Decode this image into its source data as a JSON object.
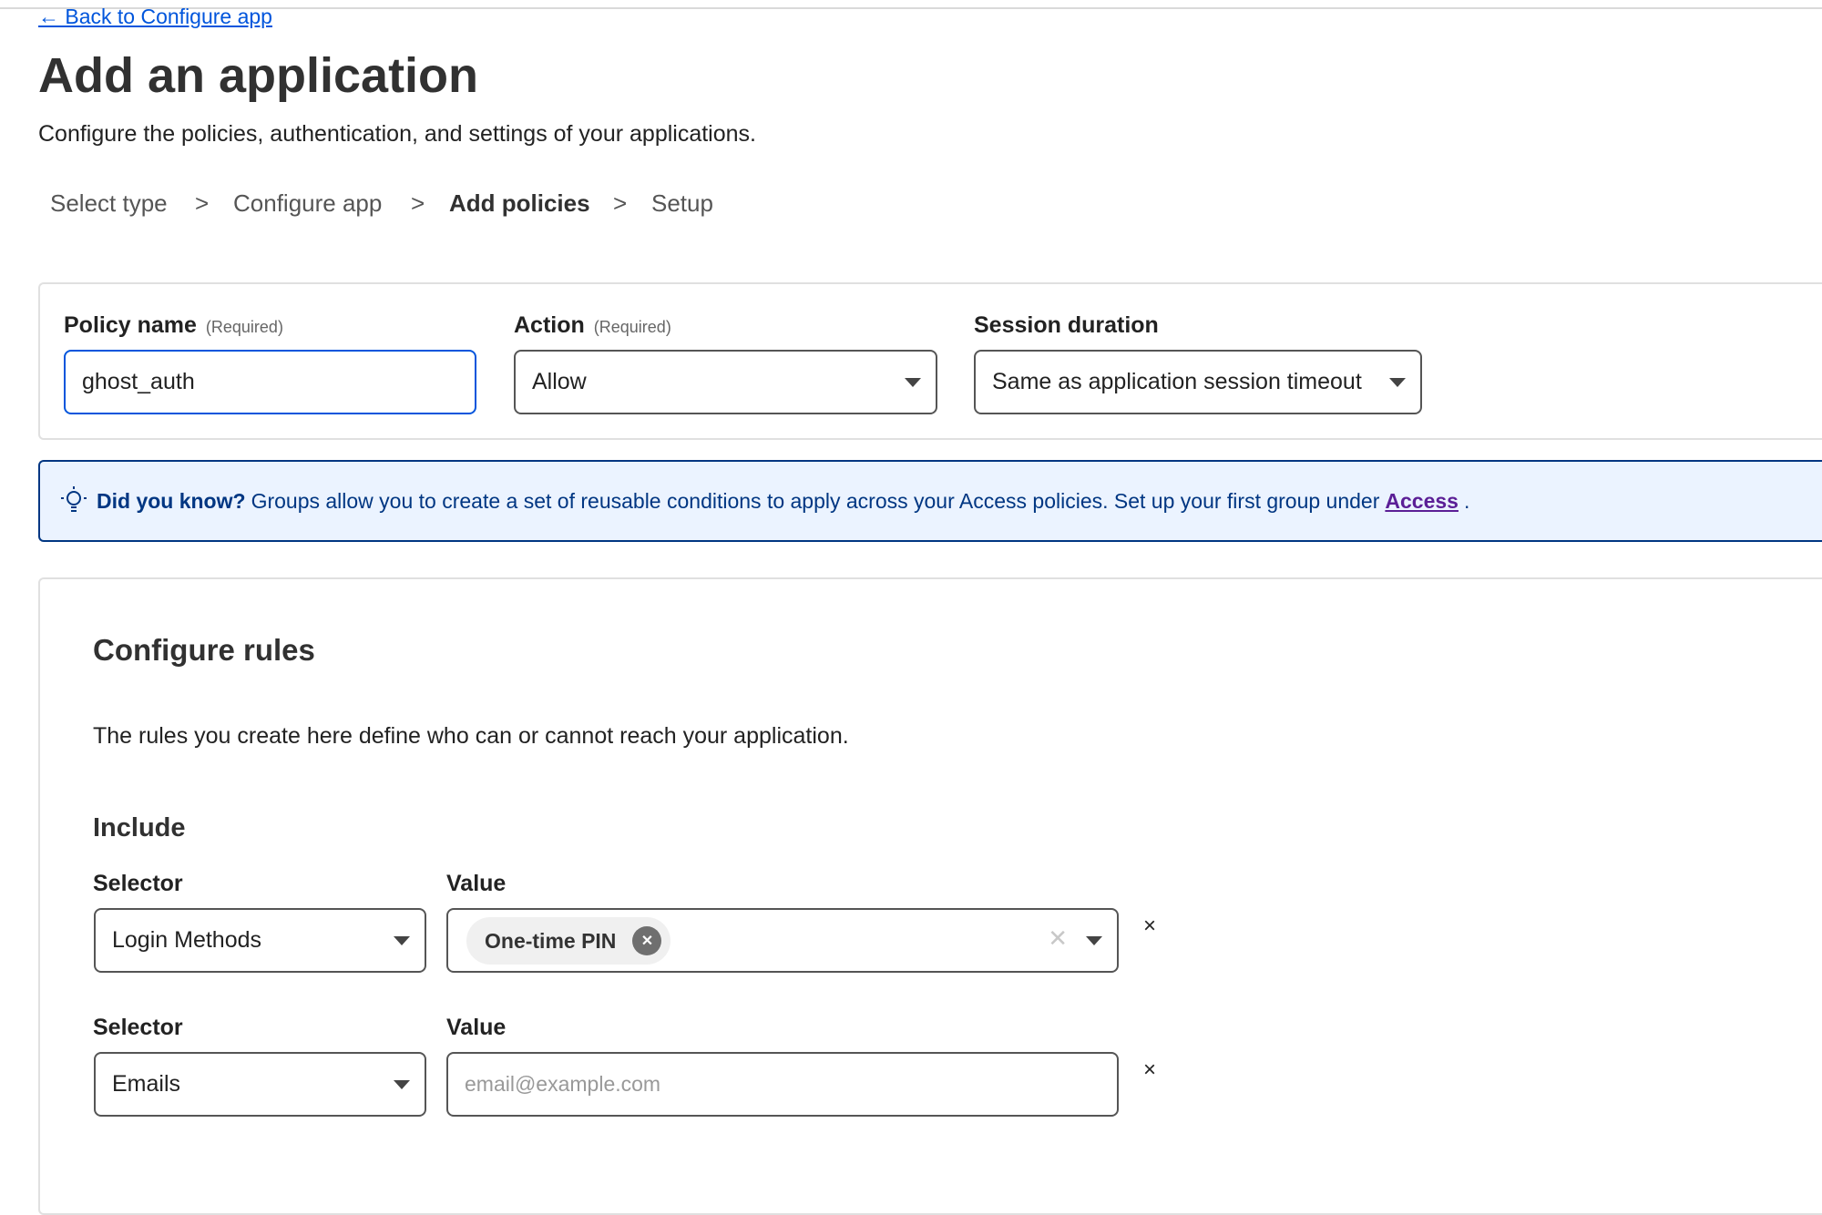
{
  "nav": {
    "back_link": "← Back to Configure app"
  },
  "header": {
    "title": "Add an application",
    "subtitle": "Configure the policies, authentication, and settings of your applications."
  },
  "steps": [
    {
      "label": "Select type"
    },
    {
      "label": "Configure app"
    },
    {
      "label": "Add policies",
      "active": true
    },
    {
      "label": "Setup"
    }
  ],
  "step_separator": ">",
  "policy": {
    "name_label": "Policy name",
    "name_required": "(Required)",
    "name_value": "ghost_auth",
    "action_label": "Action",
    "action_required": "(Required)",
    "action_value": "Allow",
    "session_label": "Session duration",
    "session_value": "Same as application session timeout"
  },
  "banner": {
    "icon": "lightbulb-icon",
    "bold": "Did you know?",
    "text": "Groups allow you to create a set of reusable conditions to apply across your Access policies. Set up your first group under",
    "link": "Access",
    "suffix": "."
  },
  "rules": {
    "title": "Configure rules",
    "description": "The rules you create here define who can or cannot reach your application.",
    "include_label": "Include",
    "rows": [
      {
        "selector_label": "Selector",
        "selector_value": "Login Methods",
        "value_label": "Value",
        "chips": [
          "One-time PIN"
        ],
        "remove": "×"
      },
      {
        "selector_label": "Selector",
        "selector_value": "Emails",
        "value_label": "Value",
        "value_placeholder": "email@example.com",
        "remove": "×"
      }
    ]
  },
  "colors": {
    "link": "#0055dc",
    "banner_bg": "#ebf3ff",
    "banner_border": "#003682",
    "focus": "#0055dc"
  }
}
